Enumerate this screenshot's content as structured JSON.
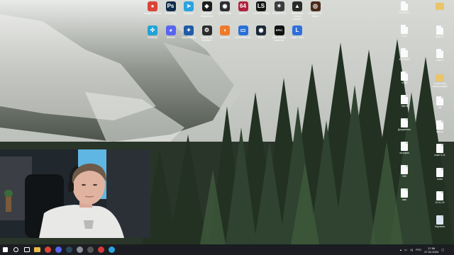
{
  "desktop": {
    "top_row": [
      {
        "label": "Google Chrome",
        "icon": "chrome-icon",
        "color": "#db4437",
        "glyph": "●"
      },
      {
        "label": "Photoshop",
        "icon": "photoshop-icon",
        "color": "#0f2a4a",
        "glyph": "Ps"
      },
      {
        "label": "Telegram",
        "icon": "telegram-icon",
        "color": "#2aa3e0",
        "glyph": "➤"
      },
      {
        "label": "GeForce Experience",
        "icon": "geforce-icon",
        "color": "#1d1d1d",
        "glyph": "◆"
      },
      {
        "label": "OBS Studio",
        "icon": "obs-icon",
        "color": "#2d2d33",
        "glyph": "◉"
      },
      {
        "label": "afterFX",
        "icon": "aftereffects-icon",
        "color": "#b0213e",
        "glyph": "64"
      },
      {
        "label": "LIGHTY Studio",
        "icon": "lighty-icon",
        "color": "#141414",
        "glyph": "LS"
      },
      {
        "label": "NVIDIA RTX",
        "icon": "nvidia-rtx-icon",
        "color": "#3b3b3b",
        "glyph": "✶"
      },
      {
        "label": "Battlestate Games Launcher",
        "icon": "battlestate-icon",
        "color": "#2a2a2a",
        "glyph": "▲"
      },
      {
        "label": "Escape from Tarkov",
        "icon": "tarkov-icon",
        "color": "#4a2a1a",
        "glyph": "◎"
      }
    ],
    "second_row": [
      {
        "label": "Sublimity",
        "icon": "sublimity-icon",
        "color": "#1fa3d8",
        "glyph": "✣"
      },
      {
        "label": "Discord",
        "icon": "discord-icon",
        "color": "#5865f2",
        "glyph": "◕"
      },
      {
        "label": "uatoolmaster",
        "icon": "uatool-icon",
        "color": "#1e5aa8",
        "glyph": "✦"
      },
      {
        "label": "Ассоц. НА Кабинет",
        "icon": "settings-icon",
        "color": "#2b2b2b",
        "glyph": "⚙"
      },
      {
        "label": "Audacity",
        "icon": "audacity-icon",
        "color": "#ee7a2a",
        "glyph": "◖"
      },
      {
        "label": "GeneralStudio",
        "icon": "generalstudio-icon",
        "color": "#2a6fd8",
        "glyph": "▭"
      },
      {
        "label": "Steam",
        "icon": "steam-icon",
        "color": "#1b2838",
        "glyph": "◉"
      },
      {
        "label": "Epic Games Launcher",
        "icon": "epic-icon",
        "color": "#111111",
        "glyph": "EPIC"
      },
      {
        "label": "Lunar Client",
        "icon": "lunar-icon",
        "color": "#2e6fdc",
        "glyph": "L"
      }
    ],
    "right_col1": [
      {
        "label": "ЕГЭ2021",
        "type": "doc"
      },
      {
        "label": "стон",
        "type": "doc"
      },
      {
        "label": "23423423",
        "type": "doc"
      },
      {
        "label": "4750",
        "type": "doc"
      },
      {
        "label": "78678",
        "type": "doc"
      },
      {
        "label": "Документы",
        "type": "doc"
      },
      {
        "label": "история",
        "type": "doc"
      },
      {
        "label": "999",
        "type": "doc"
      },
      {
        "label": "имя",
        "type": "doc"
      }
    ],
    "right_col2": [
      {
        "label": "",
        "type": "folder"
      },
      {
        "label": "aзов 11",
        "type": "doc"
      },
      {
        "label": "план 9",
        "type": "doc"
      },
      {
        "label": "Секретная информация",
        "type": "folder"
      },
      {
        "label": "hat",
        "type": "doc"
      },
      {
        "label": "мусор",
        "type": "doc"
      },
      {
        "label": "план 0.11",
        "type": "doc"
      },
      {
        "label": "план",
        "type": "doc"
      },
      {
        "label": "12.01.21",
        "type": "doc"
      },
      {
        "label": "Корзина",
        "type": "recycle"
      }
    ]
  },
  "taskbar": {
    "items": [
      {
        "name": "start-button",
        "icon": "windows-icon",
        "color": "#ffffff"
      },
      {
        "name": "search-button",
        "icon": "search-icon",
        "color": "#ffffff"
      },
      {
        "name": "taskview-button",
        "icon": "taskview-icon",
        "color": "#ffffff"
      },
      {
        "name": "taskbar-explorer",
        "icon": "folder-icon",
        "color": "#e9b949"
      },
      {
        "name": "taskbar-chrome",
        "icon": "chrome-icon",
        "color": "#db4437"
      },
      {
        "name": "taskbar-discord",
        "icon": "discord-icon",
        "color": "#5865f2"
      },
      {
        "name": "taskbar-steam",
        "icon": "steam-icon",
        "color": "#2a475e"
      },
      {
        "name": "taskbar-app",
        "icon": "shield-icon",
        "color": "#8a8f98"
      },
      {
        "name": "taskbar-obs",
        "icon": "obs-icon",
        "color": "#555555"
      },
      {
        "name": "taskbar-recorder",
        "icon": "record-icon",
        "color": "#d23b3b"
      },
      {
        "name": "taskbar-telegram",
        "icon": "telegram-icon",
        "color": "#2aa3e0"
      }
    ],
    "language": "РУС",
    "time": "17:56",
    "date": "27.02.2024"
  }
}
